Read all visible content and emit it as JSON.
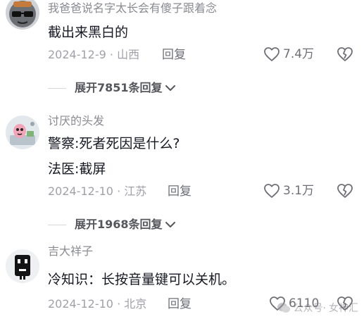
{
  "comments": [
    {
      "username": "我爸爸说名字太长会有傻子跟着念",
      "content": [
        "截出来黑白的"
      ],
      "date": "2024-12-9",
      "location": "山西",
      "reply_label": "回复",
      "likes": "7.4万",
      "expand_label": "展开7851条回复"
    },
    {
      "username": "讨厌的头发",
      "content": [
        "警察:死者死因是什么?",
        "法医:截屏"
      ],
      "date": "2024-12-10",
      "location": "江苏",
      "reply_label": "回复",
      "likes": "3.1万",
      "expand_label": "展开1968条回复"
    },
    {
      "username": "吉大祥子",
      "content": [
        "冷知识：长按音量键可以关机。"
      ],
      "date": "2024-12-10",
      "location": "北京",
      "reply_label": "回复",
      "likes": "6110",
      "expand_label": ""
    }
  ],
  "watermark": {
    "text": "女神汇",
    "prefix": "公众号·"
  },
  "icons": {
    "like": "heart-outline-icon",
    "dislike": "broken-heart-icon",
    "expand": "chevron-down-icon"
  },
  "colors": {
    "meta": "#a0a1a8",
    "username": "#8a8b91",
    "text": "#161823"
  }
}
